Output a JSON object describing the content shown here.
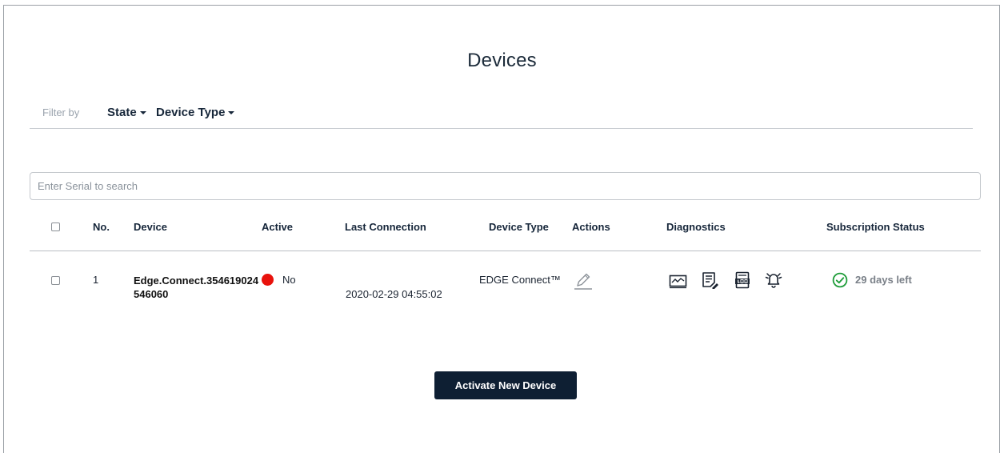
{
  "page": {
    "title": "Devices"
  },
  "filters": {
    "label": "Filter by",
    "state_label": "State",
    "device_type_label": "Device Type"
  },
  "search": {
    "placeholder": "Enter Serial to search",
    "value": ""
  },
  "table": {
    "columns": {
      "no": "No.",
      "device": "Device",
      "active": "Active",
      "last_connection": "Last Connection",
      "device_type": "Device Type",
      "actions": "Actions",
      "diagnostics": "Diagnostics",
      "subscription_status": "Subscription Status"
    },
    "rows": [
      {
        "no": "1",
        "device": "Edge.Connect.354619024546060",
        "active": "No",
        "active_color": "#e8120c",
        "last_connection": "2020-02-29 04:55:02",
        "device_type": "EDGE Connect™",
        "subscription_status": "29 days left",
        "subscription_color": "#1f9d3a",
        "action_icons": [
          "edit-icon"
        ],
        "diagnostic_icons": [
          "chart-icon",
          "report-icon",
          "log-icon",
          "alarm-bell-icon"
        ]
      }
    ]
  },
  "buttons": {
    "activate_label": "Activate New Device"
  },
  "colors": {
    "primary": "#0e1f33",
    "text": "#16263a",
    "muted": "#9aa3ad"
  }
}
